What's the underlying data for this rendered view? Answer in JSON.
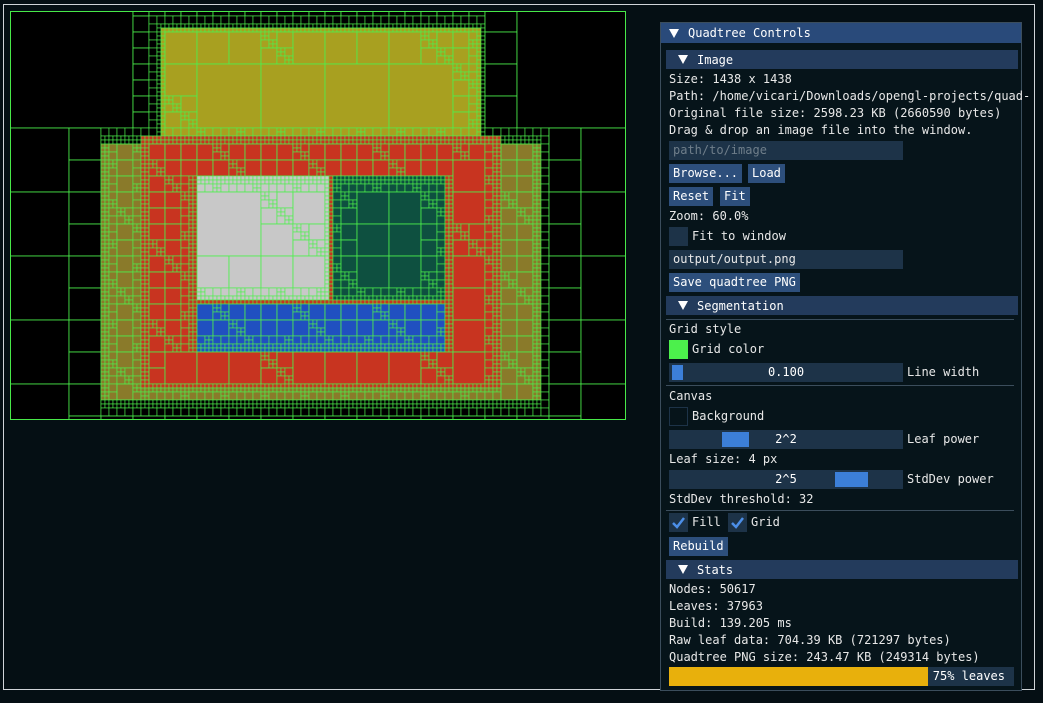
{
  "window": {
    "title": "Quadtree Controls"
  },
  "image": {
    "header": "Image",
    "size": "Size: 1438 x 1438",
    "path": "Path: /home/vicari/Downloads/opengl-projects/quad-",
    "file_size": "Original file size: 2598.23 KB (2660590 bytes)",
    "hint": "Drag & drop an image file into the window.",
    "path_input_placeholder": "path/to/image",
    "browse_label": "Browse...",
    "load_label": "Load",
    "reset_label": "Reset",
    "fit_label": "Fit",
    "zoom": "Zoom: 60.0%",
    "fit_to_window_label": "Fit to window",
    "fit_to_window_checked": false,
    "output_path": "output/output.png",
    "save_label": "Save quadtree PNG"
  },
  "segmentation": {
    "header": "Segmentation",
    "grid_style_label": "Grid style",
    "grid_color_label": "Grid color",
    "grid_color": "#4cf04c",
    "line_width_value": "0.100",
    "line_width_label": "Line width",
    "canvas_label": "Canvas",
    "background_label": "Background",
    "background_color": "#06141a",
    "leaf_power_value": "2^2",
    "leaf_power_label": "Leaf power",
    "leaf_size": "Leaf size: 4 px",
    "stddev_power_value": "2^5",
    "stddev_power_label": "StdDev power",
    "stddev_threshold": "StdDev threshold: 32",
    "fill_label": "Fill",
    "fill_checked": true,
    "grid_label": "Grid",
    "grid_checked": true,
    "rebuild_label": "Rebuild"
  },
  "stats": {
    "header": "Stats",
    "nodes": "Nodes:  50617",
    "leaves": "Leaves:  37963",
    "build": "Build:  139.205 ms",
    "raw_leaf": "Raw leaf data: 704.39 KB (721297 bytes)",
    "png_size": "Quadtree PNG size: 243.47 KB (249314 bytes)",
    "leaves_fraction": 0.75,
    "leaves_text": "75% leaves"
  },
  "colors": {
    "accent": "#3c7fd8",
    "progress": "#e8b00c",
    "grid_line": "#4cf04c",
    "emblem_red": "#c83420",
    "emblem_blue": "#2050c0",
    "emblem_teal": "#0e5040"
  }
}
